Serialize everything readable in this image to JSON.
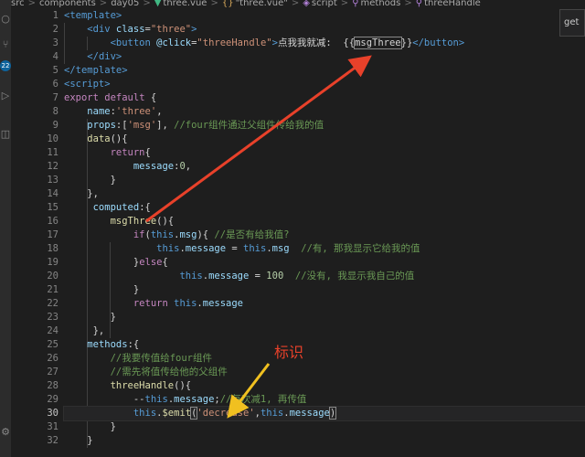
{
  "breadcrumb": {
    "items": [
      "src",
      "components",
      "day05",
      "three.vue",
      "\"three.vue\"",
      "script",
      "methods",
      "threeHandle"
    ],
    "separator": ">"
  },
  "activity_bar": {
    "badge": "22"
  },
  "tooltip_text": "get",
  "annotation_label": "标识",
  "colors": {
    "red_arrow": "#e8412a",
    "yellow_arrow": "#f0c020"
  },
  "lines": [
    {
      "n": "1",
      "tokens": [
        [
          "tag",
          "<template>"
        ]
      ]
    },
    {
      "n": "2",
      "tokens": [
        [
          "txt",
          "    "
        ],
        [
          "tag",
          "<div "
        ],
        [
          "attr",
          "class"
        ],
        [
          "txt",
          "="
        ],
        [
          "str",
          "\"three\""
        ],
        [
          "tag",
          ">"
        ]
      ]
    },
    {
      "n": "3",
      "tokens": [
        [
          "txt",
          "        "
        ],
        [
          "tag",
          "<button "
        ],
        [
          "attr",
          "@click"
        ],
        [
          "txt",
          "="
        ],
        [
          "str",
          "\"threeHandle\""
        ],
        [
          "tag",
          ">"
        ],
        [
          "txt",
          "点我我就减:  {{"
        ],
        [
          "hl",
          "msgThree"
        ],
        [
          "txt",
          "}}"
        ],
        [
          "tag",
          "</button>"
        ]
      ]
    },
    {
      "n": "4",
      "tokens": [
        [
          "txt",
          "    "
        ],
        [
          "tag",
          "</div>"
        ]
      ]
    },
    {
      "n": "5",
      "tokens": [
        [
          "tag",
          "</template>"
        ]
      ]
    },
    {
      "n": "6",
      "tokens": [
        [
          "tag",
          "<script>"
        ]
      ]
    },
    {
      "n": "7",
      "tokens": [
        [
          "ctl",
          "export "
        ],
        [
          "ctl",
          "default "
        ],
        [
          "txt",
          "{"
        ]
      ]
    },
    {
      "n": "8",
      "tokens": [
        [
          "txt",
          "    "
        ],
        [
          "prop",
          "name"
        ],
        [
          "txt",
          ":"
        ],
        [
          "str",
          "'three'"
        ],
        [
          "txt",
          ","
        ]
      ]
    },
    {
      "n": "9",
      "tokens": [
        [
          "txt",
          "    "
        ],
        [
          "prop",
          "props"
        ],
        [
          "txt",
          ":["
        ],
        [
          "str",
          "'msg'"
        ],
        [
          "txt",
          "], "
        ],
        [
          "cmt",
          "//four组件通过父组件传给我的值"
        ]
      ]
    },
    {
      "n": "10",
      "tokens": [
        [
          "txt",
          "    "
        ],
        [
          "fn",
          "data"
        ],
        [
          "txt",
          "(){"
        ]
      ]
    },
    {
      "n": "11",
      "tokens": [
        [
          "txt",
          "        "
        ],
        [
          "ctl",
          "return"
        ],
        [
          "txt",
          "{"
        ]
      ]
    },
    {
      "n": "12",
      "tokens": [
        [
          "txt",
          "            "
        ],
        [
          "prop",
          "message"
        ],
        [
          "txt",
          ":"
        ],
        [
          "num",
          "0"
        ],
        [
          "txt",
          ","
        ]
      ]
    },
    {
      "n": "13",
      "tokens": [
        [
          "txt",
          "        }"
        ]
      ]
    },
    {
      "n": "14",
      "tokens": [
        [
          "txt",
          "    },"
        ]
      ]
    },
    {
      "n": "15",
      "tokens": [
        [
          "txt",
          "     "
        ],
        [
          "prop",
          "computed"
        ],
        [
          "txt",
          ":{"
        ]
      ]
    },
    {
      "n": "16",
      "tokens": [
        [
          "txt",
          "        "
        ],
        [
          "fn",
          "msgThree"
        ],
        [
          "txt",
          "(){"
        ]
      ]
    },
    {
      "n": "17",
      "tokens": [
        [
          "txt",
          "            "
        ],
        [
          "ctl",
          "if"
        ],
        [
          "txt",
          "("
        ],
        [
          "kw",
          "this"
        ],
        [
          "txt",
          "."
        ],
        [
          "prop",
          "msg"
        ],
        [
          "txt",
          ")"
        ],
        [
          "txt",
          "{ "
        ],
        [
          "cmt",
          "//是否有给我值?"
        ]
      ]
    },
    {
      "n": "18",
      "tokens": [
        [
          "txt",
          "                "
        ],
        [
          "kw",
          "this"
        ],
        [
          "txt",
          "."
        ],
        [
          "prop",
          "message"
        ],
        [
          "txt",
          " = "
        ],
        [
          "kw",
          "this"
        ],
        [
          "txt",
          "."
        ],
        [
          "prop",
          "msg"
        ],
        [
          "txt",
          "  "
        ],
        [
          "cmt",
          "//有, 那我显示它给我的值"
        ]
      ]
    },
    {
      "n": "19",
      "tokens": [
        [
          "txt",
          "            }"
        ],
        [
          "ctl",
          "else"
        ],
        [
          "txt",
          "{"
        ]
      ]
    },
    {
      "n": "20",
      "tokens": [
        [
          "txt",
          "                    "
        ],
        [
          "kw",
          "this"
        ],
        [
          "txt",
          "."
        ],
        [
          "prop",
          "message"
        ],
        [
          "txt",
          " = "
        ],
        [
          "num",
          "100"
        ],
        [
          "txt",
          "  "
        ],
        [
          "cmt",
          "//没有, 我显示我自己的值"
        ]
      ]
    },
    {
      "n": "21",
      "tokens": [
        [
          "txt",
          "            }"
        ]
      ]
    },
    {
      "n": "22",
      "tokens": [
        [
          "txt",
          "            "
        ],
        [
          "ctl",
          "return "
        ],
        [
          "kw",
          "this"
        ],
        [
          "txt",
          "."
        ],
        [
          "prop",
          "message"
        ]
      ]
    },
    {
      "n": "23",
      "tokens": [
        [
          "txt",
          "        }"
        ]
      ]
    },
    {
      "n": "24",
      "tokens": [
        [
          "txt",
          "     },"
        ]
      ]
    },
    {
      "n": "25",
      "tokens": [
        [
          "txt",
          "    "
        ],
        [
          "prop",
          "methods"
        ],
        [
          "txt",
          ":{"
        ]
      ]
    },
    {
      "n": "26",
      "tokens": [
        [
          "txt",
          "        "
        ],
        [
          "cmt",
          "//我要传值给four组件"
        ]
      ]
    },
    {
      "n": "27",
      "tokens": [
        [
          "txt",
          "        "
        ],
        [
          "cmt",
          "//需先将值传给他的父组件"
        ]
      ]
    },
    {
      "n": "28",
      "tokens": [
        [
          "txt",
          "        "
        ],
        [
          "fn",
          "threeHandle"
        ],
        [
          "txt",
          "(){"
        ]
      ]
    },
    {
      "n": "29",
      "tokens": [
        [
          "txt",
          "            --"
        ],
        [
          "kw",
          "this"
        ],
        [
          "txt",
          "."
        ],
        [
          "prop",
          "message"
        ],
        [
          "txt",
          ";"
        ],
        [
          "cmt",
          "//每次减1, 再传值"
        ]
      ]
    },
    {
      "n": "30",
      "cur": true,
      "tokens": [
        [
          "txt",
          "            "
        ],
        [
          "kw",
          "this"
        ],
        [
          "txt",
          "."
        ],
        [
          "fn",
          "$emit"
        ],
        [
          "hl",
          "("
        ],
        [
          "str",
          "'decrease'"
        ],
        [
          "txt",
          ","
        ],
        [
          "kw",
          "this"
        ],
        [
          "txt",
          "."
        ],
        [
          "prop",
          "message"
        ],
        [
          "hl",
          ")"
        ]
      ]
    },
    {
      "n": "31",
      "tokens": [
        [
          "txt",
          "        }"
        ]
      ]
    },
    {
      "n": "32",
      "tokens": [
        [
          "txt",
          "    }"
        ]
      ]
    }
  ]
}
